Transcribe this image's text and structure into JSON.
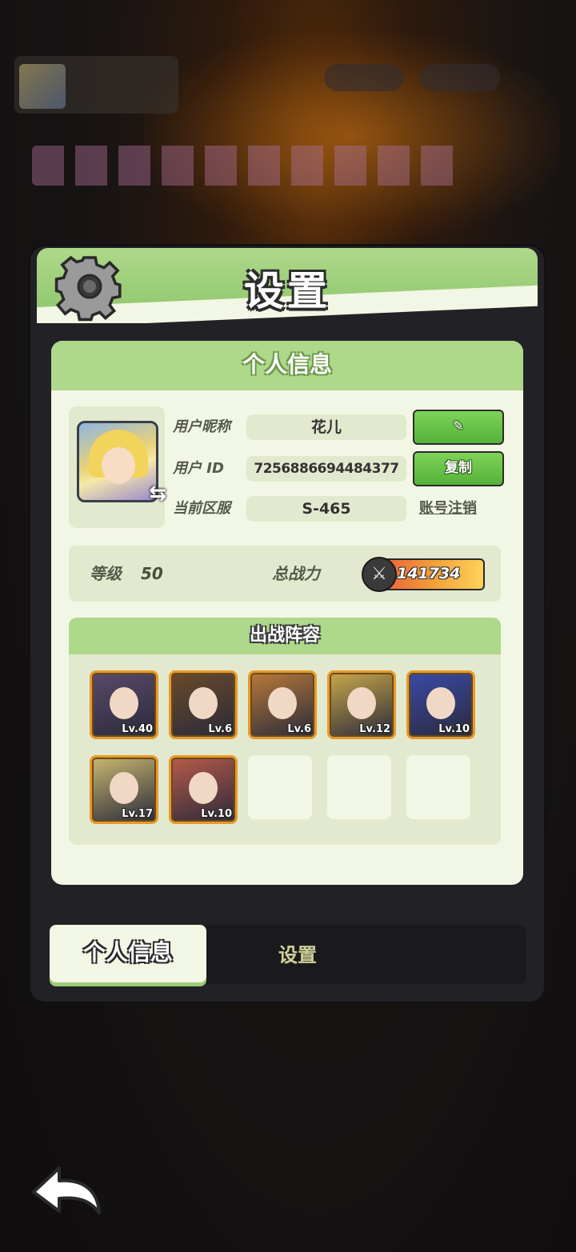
{
  "panel": {
    "title": "设置"
  },
  "profile": {
    "section_title": "个人信息",
    "nickname_label": "用户昵称",
    "nickname": "花儿",
    "edit_icon": "pencil-icon",
    "id_label": "用户 ID",
    "user_id": "7256886694484377",
    "copy_label": "复制",
    "server_label": "当前区服",
    "server": "S-465",
    "cancel_account_label": "账号注销",
    "swap_icon": "swap-arrows-icon"
  },
  "stats": {
    "level_label": "等级",
    "level": "50",
    "power_label": "总战力",
    "power": "141734",
    "power_icon": "crossed-swords-icon"
  },
  "lineup": {
    "title": "出战阵容",
    "heroes": [
      {
        "level": "Lv.40",
        "color": "#5a4a6a"
      },
      {
        "level": "Lv.6",
        "color": "#6a4a2a"
      },
      {
        "level": "Lv.6",
        "color": "#b87a3a"
      },
      {
        "level": "Lv.12",
        "color": "#c9a84a"
      },
      {
        "level": "Lv.10",
        "color": "#3a4aa8"
      },
      {
        "level": "Lv.17",
        "color": "#c9b870"
      },
      {
        "level": "Lv.10",
        "color": "#b85a4a"
      }
    ],
    "empty_slots": 3
  },
  "tabs": {
    "profile": "个人信息",
    "settings": "设置"
  },
  "colors": {
    "header_green": "#aed88a",
    "button_green": "#56b238",
    "content_bg": "#f2f6e4",
    "hero_border": "#e89a2a"
  }
}
